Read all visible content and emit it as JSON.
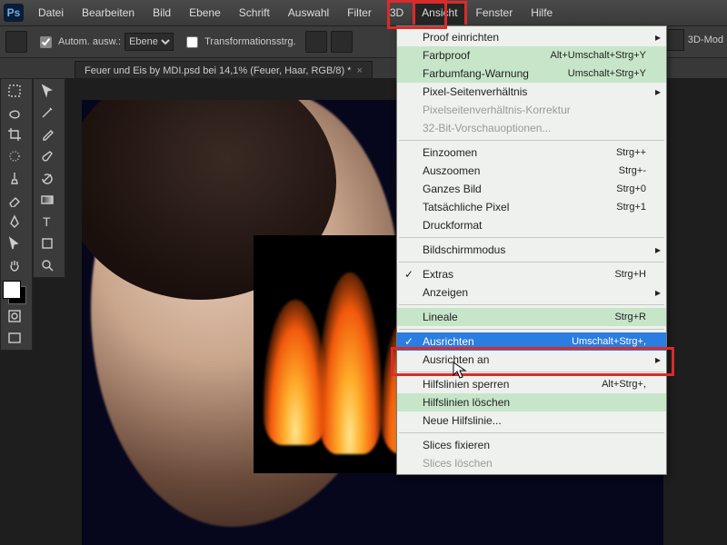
{
  "menubar": {
    "items": [
      "Datei",
      "Bearbeiten",
      "Bild",
      "Ebene",
      "Schrift",
      "Auswahl",
      "Filter",
      "3D",
      "Ansicht",
      "Fenster",
      "Hilfe"
    ],
    "open_index": 8
  },
  "optionbar": {
    "auto_select": "Autom. ausw.:",
    "dropdown": "Ebene",
    "transform": "Transformationsstrg.",
    "right_label": "3D-Mod"
  },
  "tab": {
    "title": "Feuer und Eis by MDI.psd bei 14,1% (Feuer, Haar, RGB/8) *"
  },
  "menu": {
    "groups": [
      [
        {
          "label": "Proof einrichten",
          "sub": true
        },
        {
          "label": "Farbproof",
          "shortcut": "Alt+Umschalt+Strg+Y",
          "hl": true
        },
        {
          "label": "Farbumfang-Warnung",
          "shortcut": "Umschalt+Strg+Y",
          "hl": true
        },
        {
          "label": "Pixel-Seitenverhältnis",
          "sub": true
        },
        {
          "label": "Pixelseitenverhältnis-Korrektur",
          "disabled": true
        },
        {
          "label": "32-Bit-Vorschauoptionen...",
          "disabled": true
        }
      ],
      [
        {
          "label": "Einzoomen",
          "shortcut": "Strg++"
        },
        {
          "label": "Auszoomen",
          "shortcut": "Strg+-"
        },
        {
          "label": "Ganzes Bild",
          "shortcut": "Strg+0"
        },
        {
          "label": "Tatsächliche Pixel",
          "shortcut": "Strg+1"
        },
        {
          "label": "Druckformat"
        }
      ],
      [
        {
          "label": "Bildschirmmodus",
          "sub": true
        }
      ],
      [
        {
          "label": "Extras",
          "shortcut": "Strg+H",
          "check": true
        },
        {
          "label": "Anzeigen",
          "sub": true
        }
      ],
      [
        {
          "label": "Lineale",
          "shortcut": "Strg+R",
          "hl": true
        }
      ],
      [
        {
          "label": "Ausrichten",
          "shortcut": "Umschalt+Strg+,",
          "check": true,
          "sel": true
        },
        {
          "label": "Ausrichten an",
          "sub": true
        }
      ],
      [
        {
          "label": "Hilfslinien sperren",
          "shortcut": "Alt+Strg+,"
        },
        {
          "label": "Hilfslinien löschen",
          "hl": true
        },
        {
          "label": "Neue Hilfslinie..."
        }
      ],
      [
        {
          "label": "Slices fixieren"
        },
        {
          "label": "Slices löschen",
          "disabled": true
        }
      ]
    ]
  }
}
